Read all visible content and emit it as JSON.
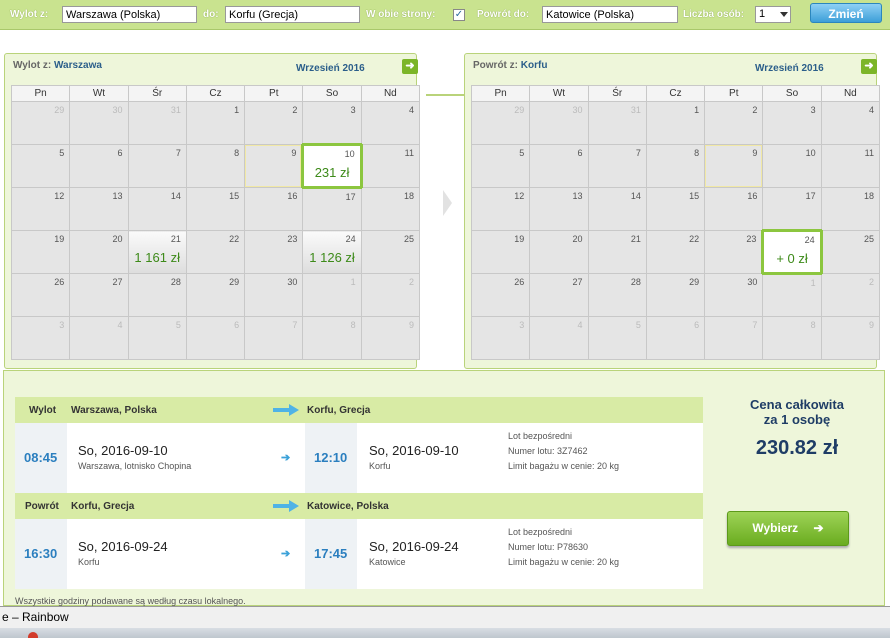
{
  "search": {
    "from_label": "Wylot z:",
    "from_value": "Warszawa (Polska)",
    "to_label": "do:",
    "to_value": "Korfu (Grecja)",
    "roundtrip_label": "W obie strony:",
    "roundtrip_checked": "✓",
    "return_label": "Powrót do:",
    "return_value": "Katowice (Polska)",
    "persons_label": "Liczba osób:",
    "persons_value": "1",
    "submit_label": "Zmień"
  },
  "weekdays": [
    "Pn",
    "Wt",
    "Śr",
    "Cz",
    "Pt",
    "So",
    "Nd"
  ],
  "calendars": [
    {
      "from_prefix": "Wylot z:",
      "from_city": "Warszawa",
      "month": "Wrzesień 2016",
      "next_icon": "arrow-right-icon",
      "weeks": [
        [
          {
            "d": "29",
            "o": 1
          },
          {
            "d": "30",
            "o": 1
          },
          {
            "d": "31",
            "o": 1
          },
          {
            "d": "1"
          },
          {
            "d": "2"
          },
          {
            "d": "3"
          },
          {
            "d": "4"
          }
        ],
        [
          {
            "d": "5"
          },
          {
            "d": "6"
          },
          {
            "d": "7"
          },
          {
            "d": "8"
          },
          {
            "d": "9",
            "hly": 1
          },
          {
            "d": "10",
            "price": "231 zł",
            "sel": 1
          },
          {
            "d": "11"
          }
        ],
        [
          {
            "d": "12"
          },
          {
            "d": "13"
          },
          {
            "d": "14"
          },
          {
            "d": "15"
          },
          {
            "d": "16"
          },
          {
            "d": "17"
          },
          {
            "d": "18"
          }
        ],
        [
          {
            "d": "19"
          },
          {
            "d": "20"
          },
          {
            "d": "21",
            "price": "1 161 zł"
          },
          {
            "d": "22"
          },
          {
            "d": "23"
          },
          {
            "d": "24",
            "price": "1 126 zł"
          },
          {
            "d": "25"
          }
        ],
        [
          {
            "d": "26"
          },
          {
            "d": "27"
          },
          {
            "d": "28"
          },
          {
            "d": "29"
          },
          {
            "d": "30"
          },
          {
            "d": "1",
            "o": 1
          },
          {
            "d": "2",
            "o": 1
          }
        ],
        [
          {
            "d": "3",
            "o": 1
          },
          {
            "d": "4",
            "o": 1
          },
          {
            "d": "5",
            "o": 1
          },
          {
            "d": "6",
            "o": 1
          },
          {
            "d": "7",
            "o": 1
          },
          {
            "d": "8",
            "o": 1
          },
          {
            "d": "9",
            "o": 1
          }
        ]
      ]
    },
    {
      "from_prefix": "Powrót z:",
      "from_city": "Korfu",
      "month": "Wrzesień 2016",
      "next_icon": "arrow-right-icon",
      "weeks": [
        [
          {
            "d": "29",
            "o": 1
          },
          {
            "d": "30",
            "o": 1
          },
          {
            "d": "31",
            "o": 1
          },
          {
            "d": "1"
          },
          {
            "d": "2"
          },
          {
            "d": "3"
          },
          {
            "d": "4"
          }
        ],
        [
          {
            "d": "5"
          },
          {
            "d": "6"
          },
          {
            "d": "7"
          },
          {
            "d": "8"
          },
          {
            "d": "9",
            "hly": 1
          },
          {
            "d": "10"
          },
          {
            "d": "11"
          }
        ],
        [
          {
            "d": "12"
          },
          {
            "d": "13"
          },
          {
            "d": "14"
          },
          {
            "d": "15"
          },
          {
            "d": "16"
          },
          {
            "d": "17"
          },
          {
            "d": "18"
          }
        ],
        [
          {
            "d": "19"
          },
          {
            "d": "20"
          },
          {
            "d": "21"
          },
          {
            "d": "22"
          },
          {
            "d": "23"
          },
          {
            "d": "24",
            "price": "+ 0 zł",
            "sel": 1
          },
          {
            "d": "25"
          }
        ],
        [
          {
            "d": "26"
          },
          {
            "d": "27"
          },
          {
            "d": "28"
          },
          {
            "d": "29"
          },
          {
            "d": "30"
          },
          {
            "d": "1",
            "o": 1
          },
          {
            "d": "2",
            "o": 1
          }
        ],
        [
          {
            "d": "3",
            "o": 1
          },
          {
            "d": "4",
            "o": 1
          },
          {
            "d": "5",
            "o": 1
          },
          {
            "d": "6",
            "o": 1
          },
          {
            "d": "7",
            "o": 1
          },
          {
            "d": "8",
            "o": 1
          },
          {
            "d": "9",
            "o": 1
          }
        ]
      ]
    }
  ],
  "outbound": {
    "label": "Wylot",
    "from": "Warszawa, Polska",
    "to": "Korfu, Grecja",
    "dep_time": "08:45",
    "dep_date": "So, 2016-09-10",
    "dep_place": "Warszawa, lotnisko Chopina",
    "arr_time": "12:10",
    "arr_date": "So, 2016-09-10",
    "arr_place": "Korfu",
    "info1": "Lot bezpośredni",
    "info2": "Numer lotu:  3Z7462",
    "info3": "Limit bagażu w cenie:  20 kg"
  },
  "inbound": {
    "label": "Powrót",
    "from": "Korfu, Grecja",
    "to": "Katowice, Polska",
    "dep_time": "16:30",
    "dep_date": "So, 2016-09-24",
    "dep_place": "Korfu",
    "arr_time": "17:45",
    "arr_date": "So, 2016-09-24",
    "arr_place": "Katowice",
    "info1": "Lot bezpośredni",
    "info2": "Numer lotu:  P78630",
    "info3": "Limit bagażu w cenie:  20 kg"
  },
  "total": {
    "line1": "Cena całkowita",
    "line2": "za 1 osobę",
    "price": "230.82 zł",
    "button": "Wybierz",
    "button_icon": "arrow-right-icon"
  },
  "note": "Wszystkie godziny podawane są według czasu lokalnego.",
  "taskbar": {
    "title": "e – Rainbow"
  }
}
